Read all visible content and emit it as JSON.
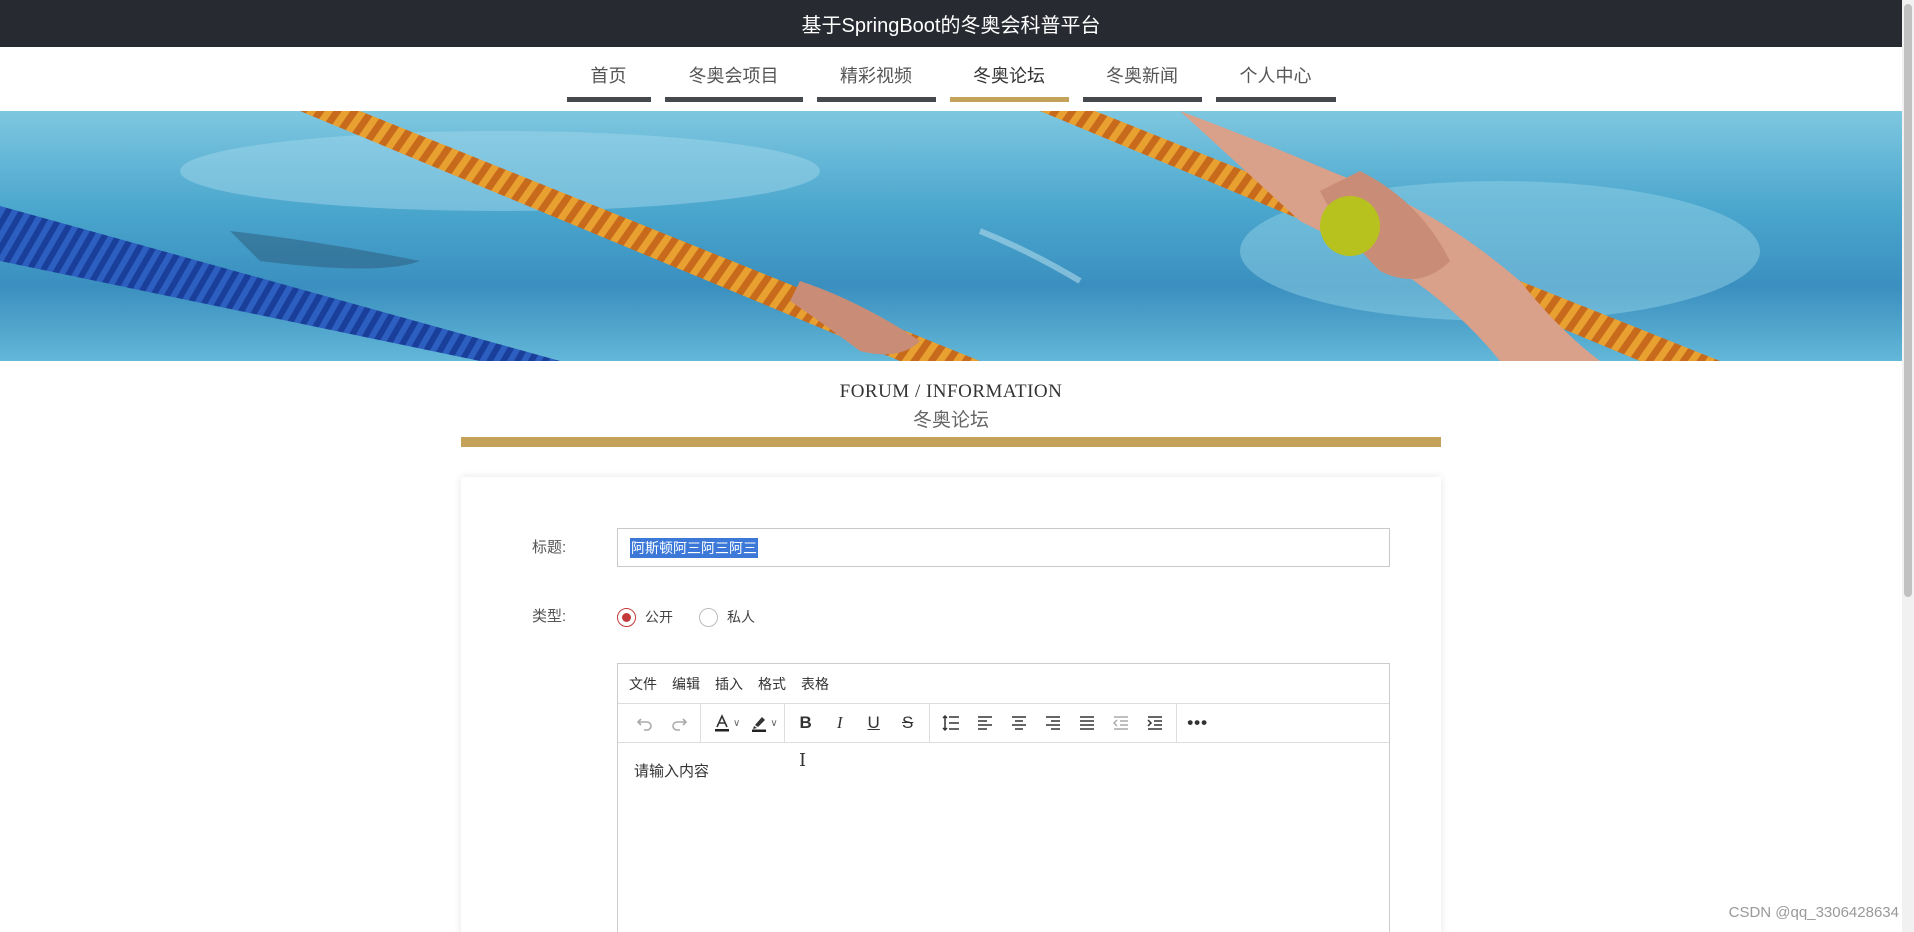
{
  "app": {
    "title": "基于SpringBoot的冬奥会科普平台"
  },
  "nav": {
    "items": [
      {
        "label": "首页",
        "active": false
      },
      {
        "label": "冬奥会项目",
        "active": false
      },
      {
        "label": "精彩视频",
        "active": false
      },
      {
        "label": "冬奥论坛",
        "active": true
      },
      {
        "label": "冬奥新闻",
        "active": false
      },
      {
        "label": "个人中心",
        "active": false
      }
    ]
  },
  "section": {
    "title_en": "FORUM / INFORMATION",
    "title_cn": "冬奥论坛"
  },
  "form": {
    "title_label": "标题:",
    "title_value": "阿斯顿阿三阿三阿三",
    "type_label": "类型:",
    "type_options": [
      {
        "label": "公开",
        "checked": true
      },
      {
        "label": "私人",
        "checked": false
      }
    ]
  },
  "editor": {
    "menu": [
      "文件",
      "编辑",
      "插入",
      "格式",
      "表格"
    ],
    "toolbar": [
      "undo-icon",
      "redo-icon",
      "font-color-icon",
      "highlight-color-icon",
      "bold-icon",
      "italic-icon",
      "underline-icon",
      "strikethrough-icon",
      "line-height-icon",
      "align-left-icon",
      "align-center-icon",
      "align-right-icon",
      "align-justify-icon",
      "outdent-icon",
      "indent-icon",
      "more-icon"
    ],
    "placeholder": "请输入内容"
  },
  "watermark": "CSDN @qq_3306428634",
  "colors": {
    "accent": "#c4a259",
    "topbar": "#272a30",
    "radio": "#c43a3a",
    "selection": "#3b78d8"
  }
}
